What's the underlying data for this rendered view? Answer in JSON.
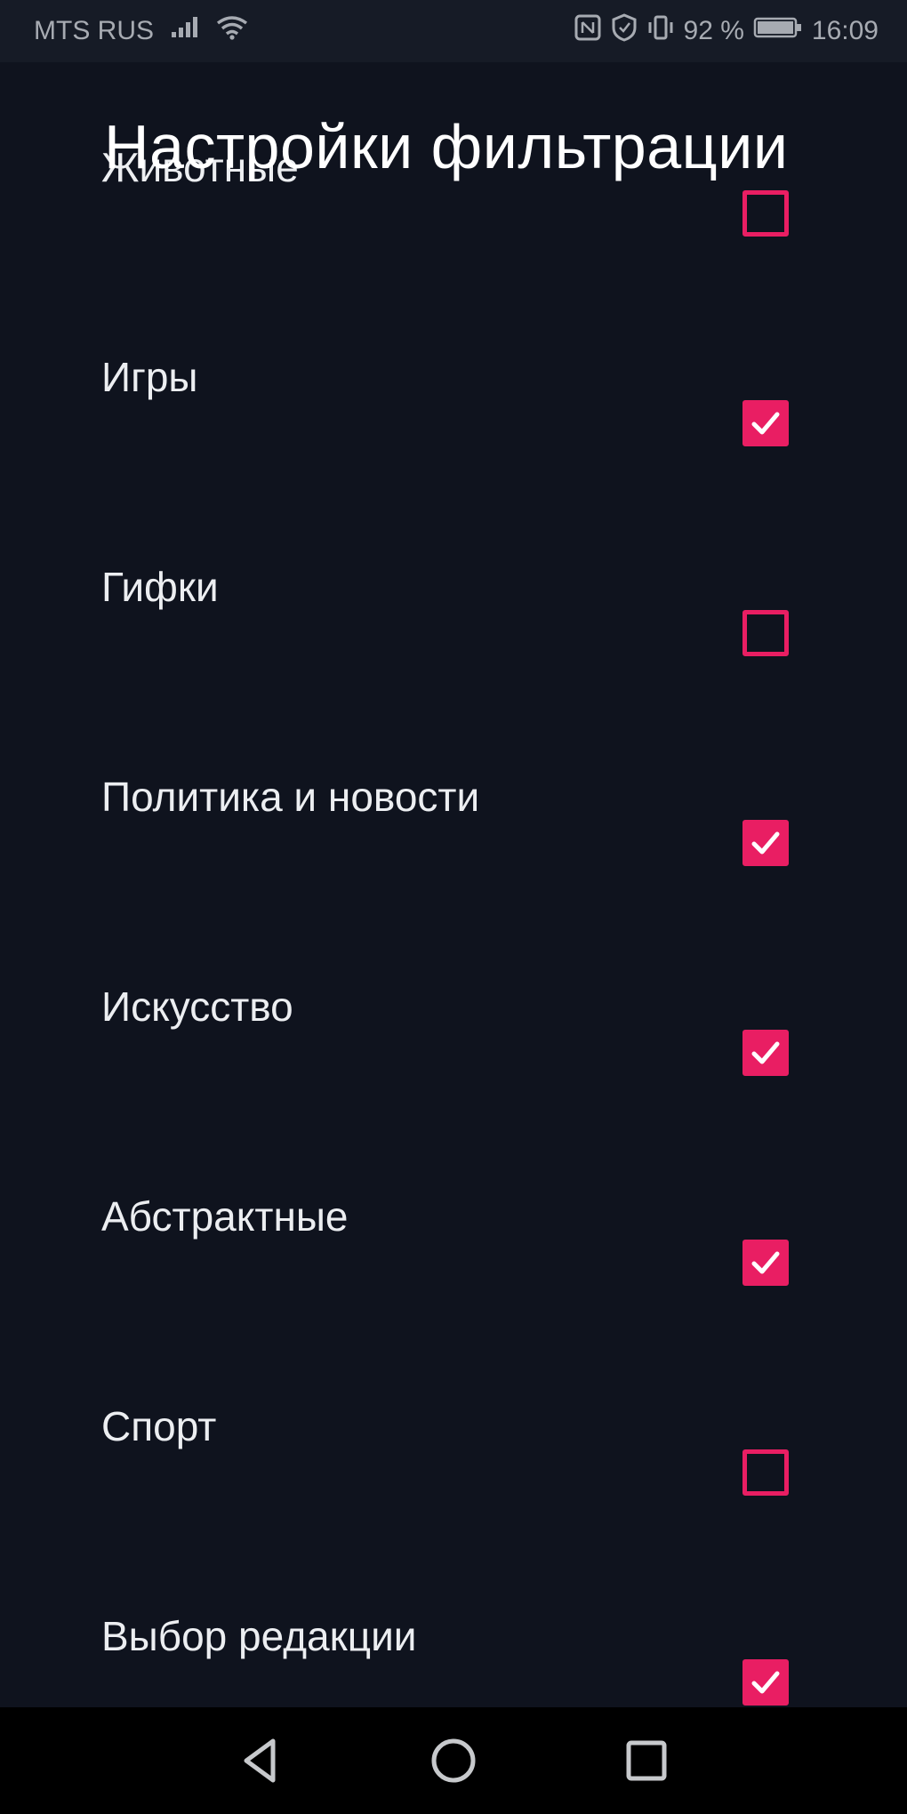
{
  "status_bar": {
    "carrier": "MTS RUS",
    "battery_percent": "92 %",
    "time": "16:09"
  },
  "screen": {
    "title": "Настройки фильтрации"
  },
  "filters": [
    {
      "label": "Животные",
      "checked": false
    },
    {
      "label": "Игры",
      "checked": true
    },
    {
      "label": "Гифки",
      "checked": false
    },
    {
      "label": "Политика и новости",
      "checked": true
    },
    {
      "label": "Искусство",
      "checked": true
    },
    {
      "label": "Абстрактные",
      "checked": true
    },
    {
      "label": "Спорт",
      "checked": false
    },
    {
      "label": "Выбор редакции",
      "checked": true
    }
  ],
  "colors": {
    "background": "#0f131e",
    "accent": "#e91e63",
    "text": "#eceef1"
  },
  "icons": {
    "nav_back": "back-triangle-icon",
    "nav_home": "home-circle-icon",
    "nav_recents": "recents-square-icon"
  }
}
